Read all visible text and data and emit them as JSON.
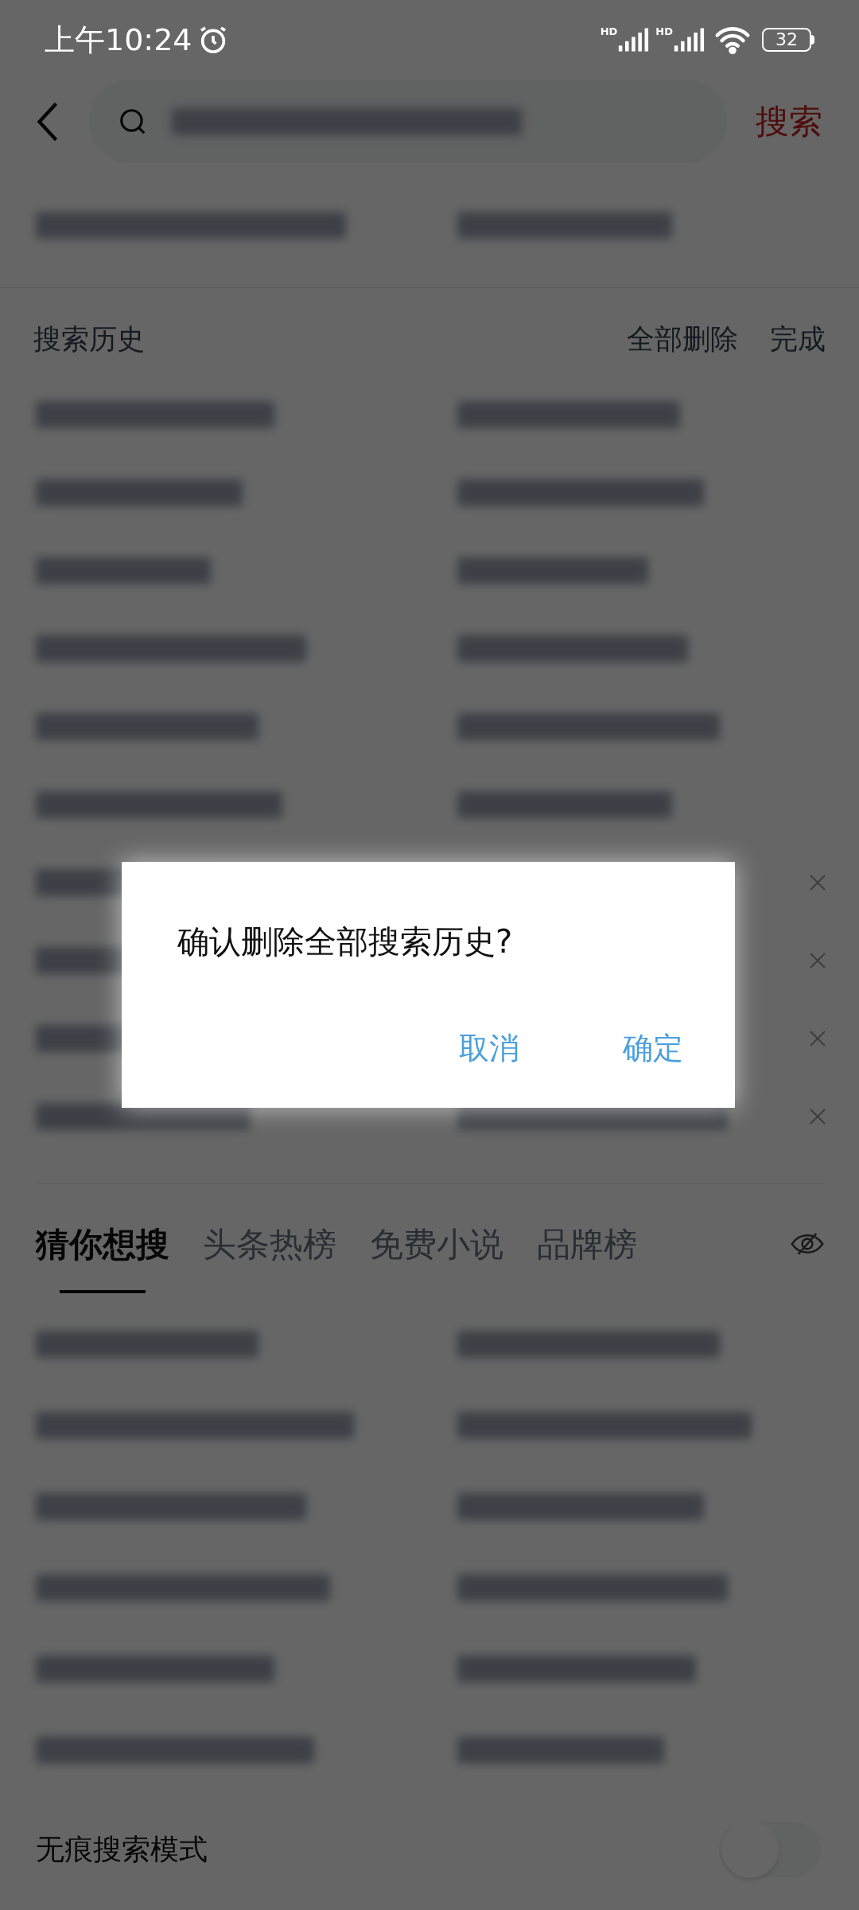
{
  "status_bar": {
    "time": "上午10:24",
    "network": [
      "HD",
      "HD"
    ],
    "battery": "32"
  },
  "search_bar": {
    "button": "搜索"
  },
  "history": {
    "title": "搜索历史",
    "actions": [
      "全部删除",
      "完成"
    ],
    "rows": [
      {
        "delete_icon": false
      },
      {
        "delete_icon": false
      },
      {
        "delete_icon": false
      },
      {
        "delete_icon": false
      },
      {
        "delete_icon": false
      },
      {
        "delete_icon": false
      },
      {
        "delete_icon": true
      },
      {
        "delete_icon": true
      },
      {
        "delete_icon": true
      },
      {
        "delete_icon": true
      }
    ]
  },
  "tabs": [
    {
      "label": "猜你想搜",
      "selected": true
    },
    {
      "label": "头条热榜",
      "selected": false
    },
    {
      "label": "免费小说",
      "selected": false
    },
    {
      "label": "品牌榜",
      "selected": false
    }
  ],
  "incognito": {
    "label": "无痕搜索模式",
    "on": false
  },
  "dialog": {
    "message": "确认删除全部搜索历史?",
    "buttons": [
      "取消",
      "确定"
    ]
  }
}
